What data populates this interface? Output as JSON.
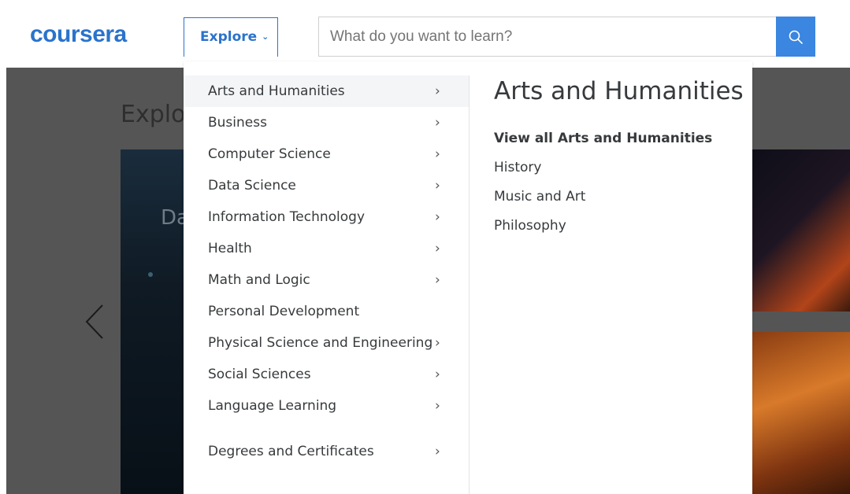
{
  "header": {
    "logo_text": "coursera",
    "explore_label": "Explore",
    "explore_chevron": "⌄",
    "search_placeholder": "What do you want to learn?",
    "search_icon": "search-icon",
    "accent_color": "#2a73cc"
  },
  "background": {
    "title_partial": "Explo",
    "card_text_partial": "Da"
  },
  "menu": {
    "categories": [
      {
        "label": "Arts and Humanities",
        "has_arrow": true,
        "active": true
      },
      {
        "label": "Business",
        "has_arrow": true
      },
      {
        "label": "Computer Science",
        "has_arrow": true
      },
      {
        "label": "Data Science",
        "has_arrow": true
      },
      {
        "label": "Information Technology",
        "has_arrow": true
      },
      {
        "label": "Health",
        "has_arrow": true
      },
      {
        "label": "Math and Logic",
        "has_arrow": true
      },
      {
        "label": "Personal Development",
        "has_arrow": false
      },
      {
        "label": "Physical Science and Engineering",
        "has_arrow": true
      },
      {
        "label": "Social Sciences",
        "has_arrow": true
      },
      {
        "label": "Language Learning",
        "has_arrow": true
      },
      {
        "label": "Degrees and Certificates",
        "has_arrow": true
      }
    ],
    "arrow_glyph": "›",
    "submenu": {
      "title": "Arts and Humanities",
      "links": [
        {
          "label": "View all Arts and Humanities",
          "bold": true
        },
        {
          "label": "History"
        },
        {
          "label": "Music and Art"
        },
        {
          "label": "Philosophy"
        }
      ]
    }
  }
}
